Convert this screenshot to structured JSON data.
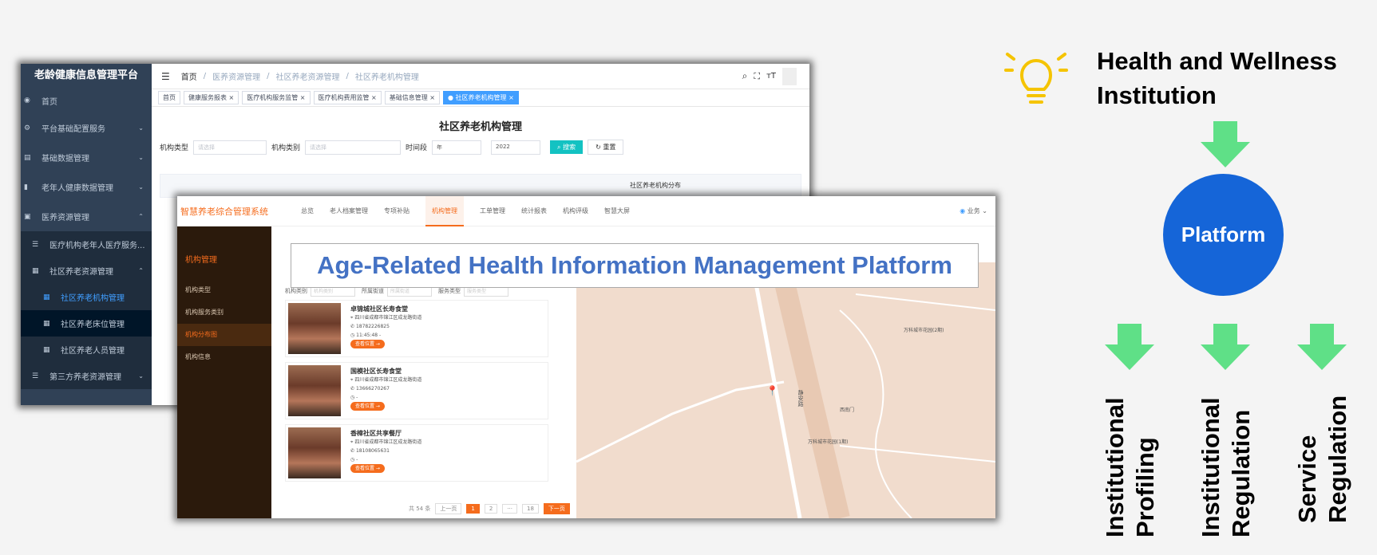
{
  "back_window": {
    "app_title": "老龄健康信息管理平台",
    "sidebar": [
      {
        "label": "首页"
      },
      {
        "label": "平台基础配置服务"
      },
      {
        "label": "基础数据管理"
      },
      {
        "label": "老年人健康数据管理"
      },
      {
        "label": "医养资源管理"
      },
      {
        "label": "医疗机构老年人医疗服务..."
      },
      {
        "label": "社区养老资源管理"
      },
      {
        "label": "社区养老机构管理"
      },
      {
        "label": "社区养老床位管理"
      },
      {
        "label": "社区养老人员管理"
      },
      {
        "label": "第三方养老资源管理"
      }
    ],
    "breadcrumb": [
      "首页",
      "医养资源管理",
      "社区养老资源管理",
      "社区养老机构管理"
    ],
    "tabs": [
      "首页",
      "健康服务报表",
      "医疗机构服务监管",
      "医疗机构费用监管",
      "基础信息管理",
      "社区养老机构管理"
    ],
    "page_title": "社区养老机构管理",
    "filters": {
      "type_label": "机构类型",
      "type_placeholder": "请选择",
      "category_label": "机构类别",
      "category_placeholder": "请选择",
      "period_label": "时间段",
      "period_value": "年",
      "year_value": "2022",
      "search_button": "搜索",
      "reset_button": "重置"
    },
    "table_header": "社区养老机构分布"
  },
  "front_window": {
    "brand": "智慧养老综合管理系统",
    "nav": [
      "总览",
      "老人档案管理",
      "专项补贴",
      "机构管理",
      "工单管理",
      "统计报表",
      "机构评级",
      "智慧大屏"
    ],
    "nav_active": "机构管理",
    "user": "业务",
    "sidebar_title": "机构管理",
    "sidebar_items": [
      "机构类型",
      "机构服务类别",
      "机构分布图",
      "机构信息"
    ],
    "sidebar_active": "机构分布图",
    "filters": [
      {
        "label": "机构类别",
        "placeholder": "机构类别"
      },
      {
        "label": "所属街道",
        "placeholder": "所属街道"
      },
      {
        "label": "服务类型",
        "placeholder": "服务类型"
      }
    ],
    "cards": [
      {
        "name": "卓锦城社区长寿食堂",
        "address": "四川省成都市锦江区成龙路街道",
        "phone": "18782226825",
        "hours": "11:45:48 -",
        "button": "查看位置"
      },
      {
        "name": "国模社区长寿食堂",
        "address": "四川省成都市锦江区成龙路街道",
        "phone": "13666270267",
        "hours": "-",
        "button": "查看位置"
      },
      {
        "name": "香樟社区共享餐厅",
        "address": "四川省成都市锦江区成龙路街道",
        "phone": "18108065631",
        "hours": "-",
        "button": "查看位置"
      }
    ],
    "pager": {
      "total": "共 54 条",
      "prev": "上一页",
      "pages": [
        "1",
        "2",
        "···",
        "18"
      ],
      "next": "下一页"
    },
    "map_labels": [
      "静安路",
      "万科城市花园(2期)",
      "西南门",
      "万科城市花园(1期)"
    ]
  },
  "overlay_title": "Age-Related Health Information Management Platform",
  "diagram": {
    "top_label_line1": "Health and Wellness",
    "top_label_line2": "Institution",
    "center_label": "Platform",
    "outputs": [
      {
        "line1": "Institutional",
        "line2": "Profiling"
      },
      {
        "line1": "Institutional",
        "line2": "Regulation"
      },
      {
        "line1": "Service",
        "line2": "Regulation"
      }
    ],
    "arrow_color": "#5fe087",
    "circle_color": "#1565d8",
    "bulb_color": "#f5c400"
  }
}
